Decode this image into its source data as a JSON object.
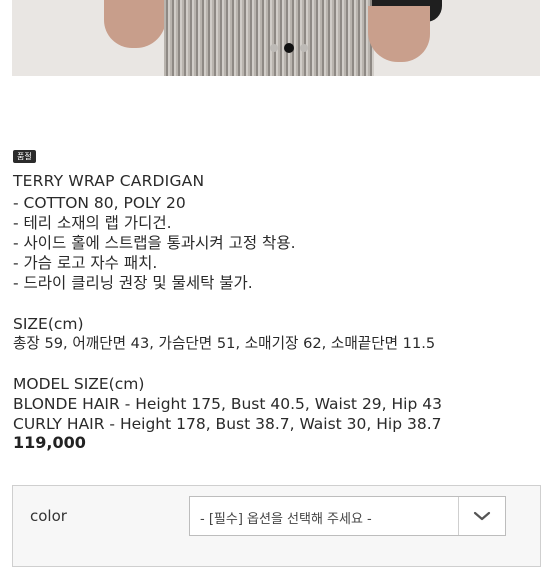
{
  "product": {
    "badge": "품절",
    "name": "TERRY WRAP CARDIGAN",
    "details": [
      "- COTTON 80, POLY 20",
      "- 테리 소재의 랩 가디건.",
      "- 사이드 홀에 스트랩을 통과시켜 고정 착용.",
      "- 가슴 로고 자수 패치.",
      "- 드라이 클리닝 권장 및 물세탁 불가."
    ],
    "size_heading": "SIZE(cm)",
    "size_values": "총장 59, 어깨단면 43, 가슴단면 51, 소매기장 62, 소매끝단면 11.5",
    "model_heading": "MODEL SIZE(cm)",
    "models": [
      "BLONDE HAIR - Height 175, Bust 40.5, Waist 29, Hip 43",
      "CURLY HAIR - Height 178, Bust 38.7, Waist 30, Hip 38.7"
    ],
    "price": "119,000"
  },
  "carousel": {
    "active_index": 2,
    "count": 3
  },
  "options": {
    "color_label": "color",
    "color_select_value": "- [필수] 옵션을 선택해 주세요 -"
  }
}
